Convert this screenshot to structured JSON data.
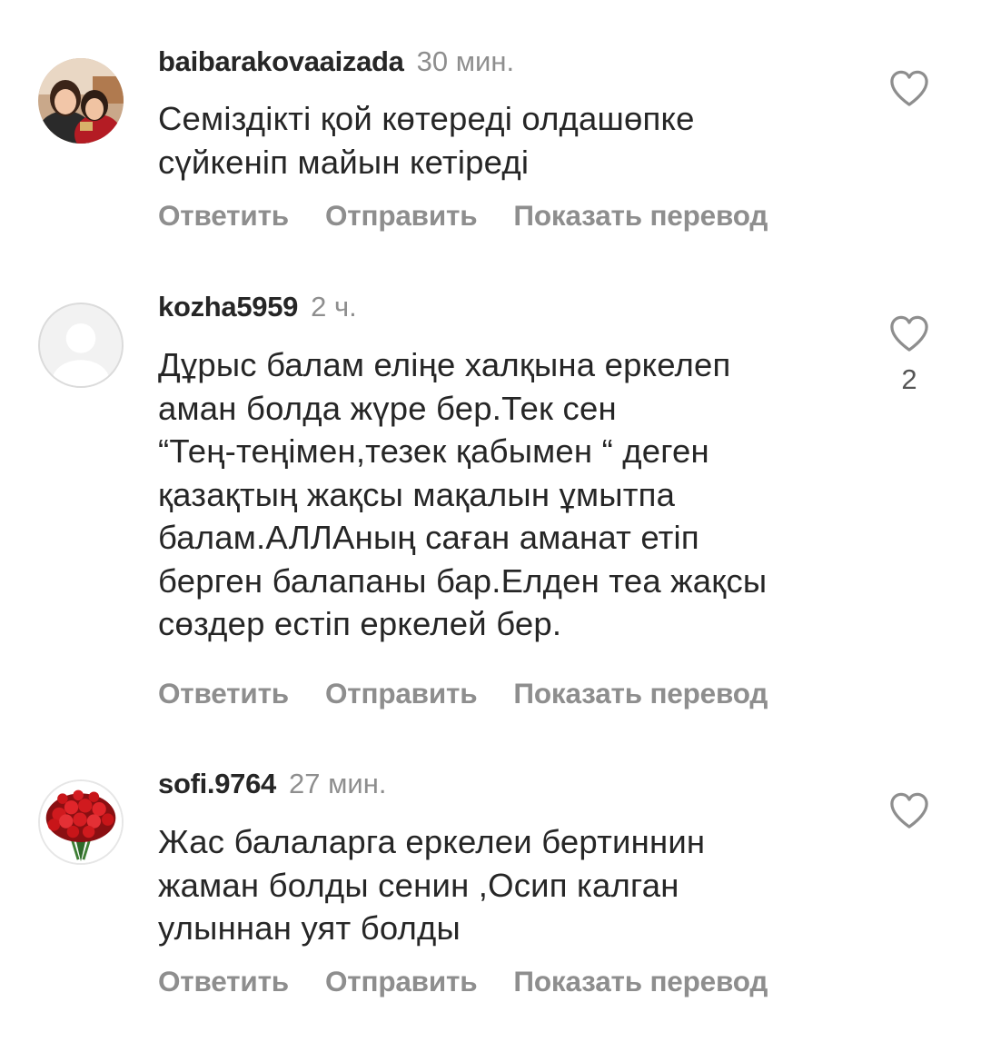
{
  "comments": [
    {
      "username": "baibarakovaaizada",
      "time": "30 мин.",
      "text": "Семіздікті қой көтереді олдашөпке\nсүйкеніп майын кетіреді",
      "like_count": null,
      "actions": {
        "reply": "Ответить",
        "send": "Отправить",
        "translate": "Показать перевод"
      }
    },
    {
      "username": "kozha5959",
      "time": "2 ч.",
      "text": "Дұрыс балам еліңе  халқына еркелеп\nаман болда жүре бер.Тек  сен\n“Тең-теңімен,тезек қабымен “ деген\nқазақтың жақсы мақалын ұмытпа\nбалам.АЛЛАның саған аманат етіп\nберген балапаны бар.Елден теа жақсы\nсөздер естіп еркелей бер.",
      "like_count": "2",
      "actions": {
        "reply": "Ответить",
        "send": "Отправить",
        "translate": "Показать перевод"
      }
    },
    {
      "username": "sofi.9764",
      "time": "27 мин.",
      "text": "Жас балаларга еркелеи бертиннин\nжаман болды сенин ,Осип калган\nулыннан уят болды",
      "like_count": null,
      "actions": {
        "reply": "Ответить",
        "send": "Отправить",
        "translate": "Показать перевод"
      }
    }
  ],
  "icons": {
    "like": "heart-outline-icon",
    "default_avatar": "default-user-avatar-icon"
  },
  "colors": {
    "text": "#262626",
    "secondary": "#8e8e8e"
  }
}
